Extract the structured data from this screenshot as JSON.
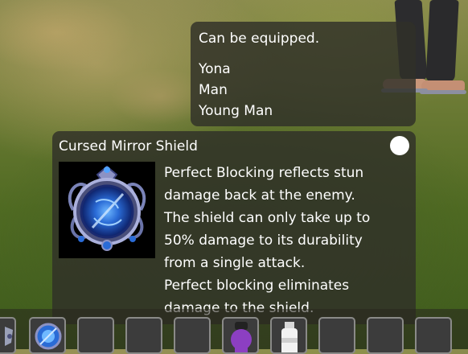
{
  "equip_panel": {
    "heading": "Can be equipped.",
    "characters": [
      "Yona",
      "Man",
      "Young Man"
    ]
  },
  "item_panel": {
    "name": "Cursed Mirror Shield",
    "description_lines": [
      "Perfect Blocking reflects stun",
      "damage back at the enemy.",
      "The shield can only take up to",
      "50% damage to its durability",
      "from a single attack.",
      "Perfect blocking eliminates",
      "damage to the shield."
    ],
    "image_icon": "cursed-mirror-shield-icon"
  },
  "hotbar": {
    "slots": [
      {
        "id": "slot-1",
        "icon": "partial-item-icon"
      },
      {
        "id": "slot-2",
        "icon": "mirror-shield-icon"
      },
      {
        "id": "slot-3",
        "icon": ""
      },
      {
        "id": "slot-4",
        "icon": ""
      },
      {
        "id": "slot-5",
        "icon": ""
      },
      {
        "id": "slot-6",
        "icon": "purple-potion-icon"
      },
      {
        "id": "slot-7",
        "icon": "milk-bottle-icon"
      },
      {
        "id": "slot-8",
        "icon": ""
      },
      {
        "id": "slot-9",
        "icon": ""
      },
      {
        "id": "slot-10",
        "icon": ""
      }
    ]
  },
  "colors": {
    "panel_bg": "#30302a",
    "text": "#ffffff",
    "slot_border": "#8a8a88"
  }
}
